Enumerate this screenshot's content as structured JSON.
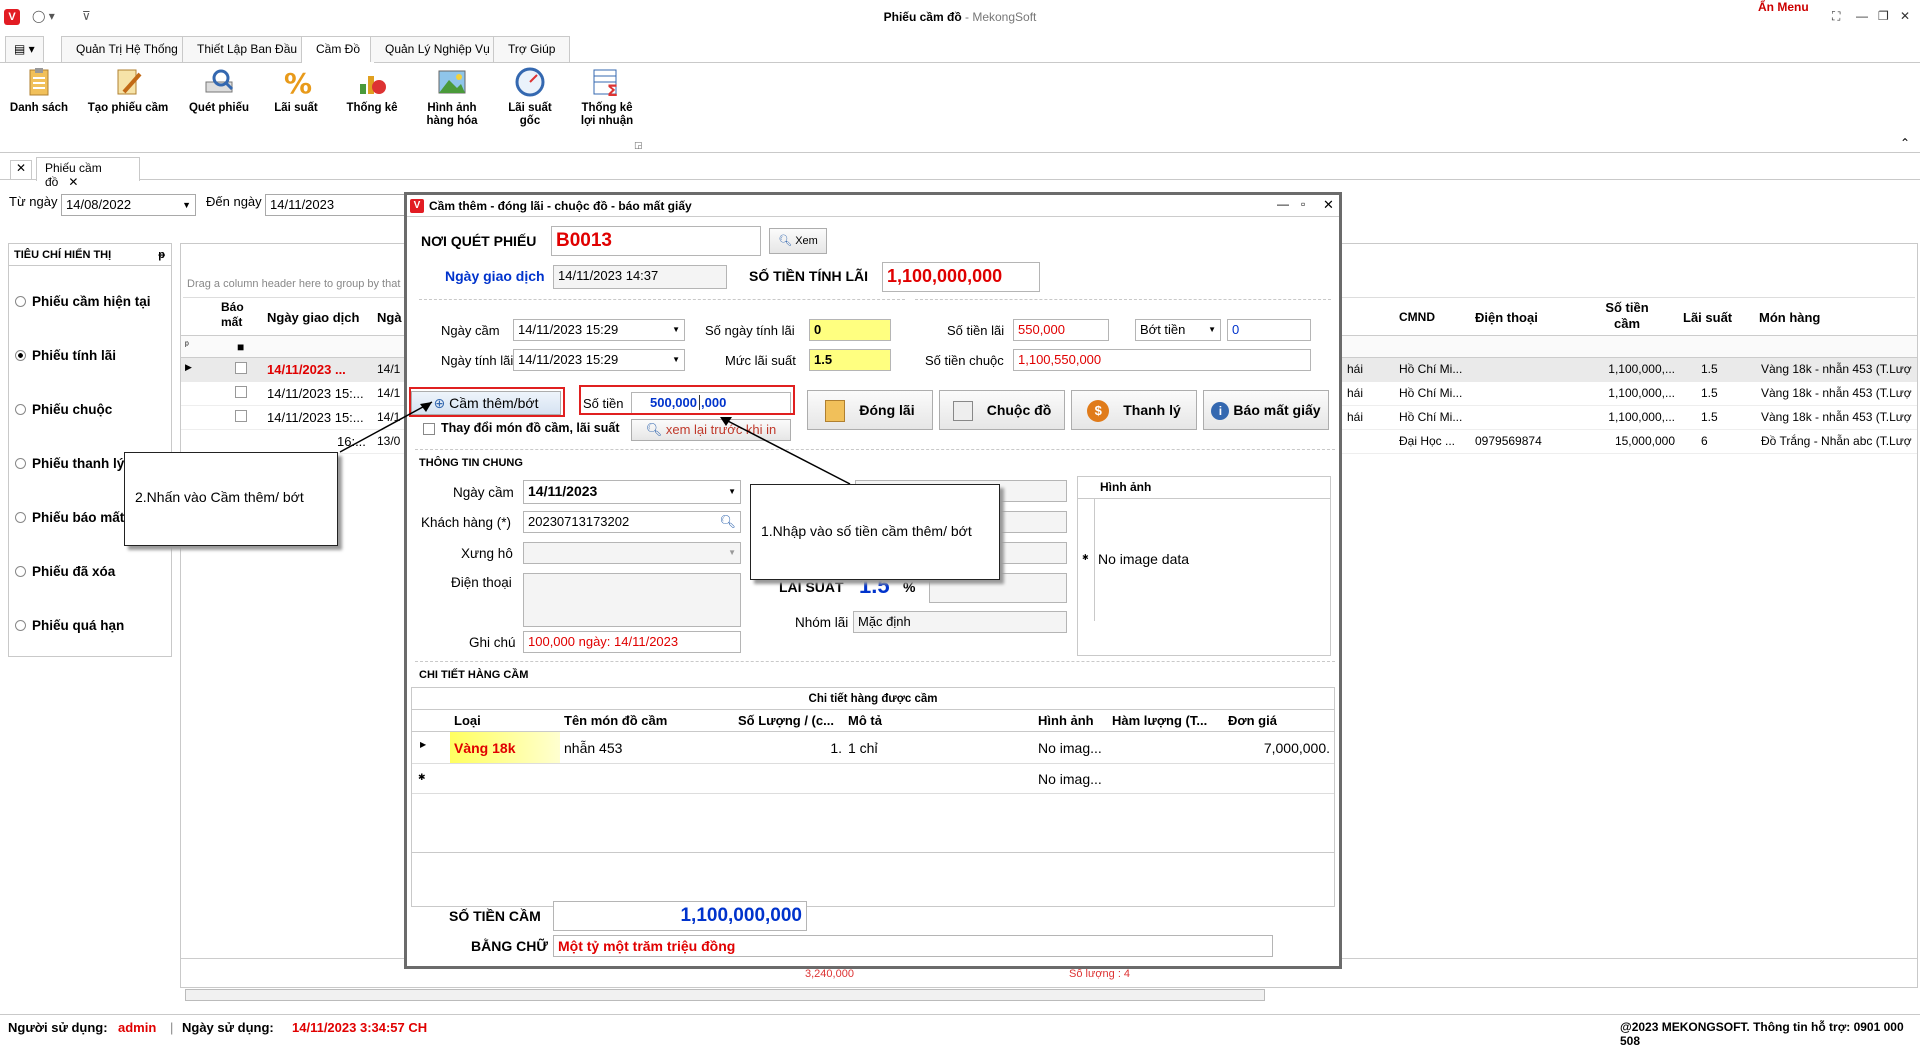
{
  "window": {
    "title": "Phiếu cầm đồ",
    "subtitle": " - MekongSoft",
    "hide_menu": "Ẩn Menu",
    "logo": "V"
  },
  "ribbon_tabs": [
    "Quản Trị Hệ Thống",
    "Thiết Lập Ban Đầu",
    "Cầm Đồ",
    "Quản Lý Nghiệp Vụ",
    "Trợ Giúp"
  ],
  "ribbon_buttons": [
    {
      "label": "Danh sách",
      "icon": "clipboard-icon"
    },
    {
      "label": "Tạo phiếu cầm",
      "icon": "edit-document-icon"
    },
    {
      "label": "Quét phiếu",
      "icon": "scanner-icon"
    },
    {
      "label": "Lãi suất",
      "icon": "percent-icon"
    },
    {
      "label": "Thống kê",
      "icon": "bar-chart-icon"
    },
    {
      "label": "Hình ảnh",
      "label2": "hàng hóa",
      "icon": "picture-icon"
    },
    {
      "label": "Lãi suất",
      "label2": "gốc",
      "icon": "gauge-icon"
    },
    {
      "label": "Thống kê",
      "label2": "lợi nhuận",
      "icon": "sum-table-icon"
    }
  ],
  "doc_tab": "Phiếu cầm đồ",
  "filter": {
    "from_label": "Từ ngày",
    "from_value": "14/08/2022",
    "to_label": "Đến ngày",
    "to_value": "14/11/2023"
  },
  "left_panel": {
    "header": "TIÊU CHÍ HIỂN THỊ",
    "pin": "ᵽ",
    "options": [
      "Phiếu cầm hiện tại",
      "Phiếu tính lãi",
      "Phiếu chuộc",
      "Phiếu thanh lý",
      "Phiếu báo mất",
      "Phiếu đã xóa",
      "Phiếu quá hạn"
    ],
    "selected": 1
  },
  "grid": {
    "group_hint": "Drag a column header here to group by that column",
    "col_bao_mat": [
      "Báo",
      "mất"
    ],
    "col_ngay": "Ngày giao dịch",
    "col_ng2": "Ngà",
    "right_cols": [
      "CMND",
      "Điện thoại",
      "Số tiền",
      "cầm",
      "Lãi suất",
      "Món hàng"
    ],
    "rows_left": [
      {
        "date": "14/11/2023 ...",
        "extra": "14/1",
        "red": true
      },
      {
        "date": "14/11/2023 15:...",
        "extra": "14/1",
        "red": false
      },
      {
        "date": "14/11/2023 15:...",
        "extra": "14/1",
        "red": false
      },
      {
        "date": "16:...",
        "extra": "13/0",
        "red": false
      }
    ],
    "rows_right": [
      {
        "pre": "hái",
        "cmnd": "Hồ Chí Mi...",
        "phone": "",
        "amount": "1,100,000,...",
        "rate": "1.5",
        "item": "Vàng 18k - nhẫn 453 (T.Lượ"
      },
      {
        "pre": "hái",
        "cmnd": "Hồ Chí Mi...",
        "phone": "",
        "amount": "1,100,000,...",
        "rate": "1.5",
        "item": "Vàng 18k - nhẫn 453 (T.Lượ"
      },
      {
        "pre": "hái",
        "cmnd": "Hồ Chí Mi...",
        "phone": "",
        "amount": "1,100,000,...",
        "rate": "1.5",
        "item": "Vàng 18k - nhẫn 453 (T.Lượ"
      },
      {
        "pre": "hái",
        "cmnd": "Đại Học ...",
        "phone": "0979569874",
        "amount": "15,000,000",
        "rate": "6",
        "item": "Đồ Trắng - Nhẫn abc (T.Lượ"
      }
    ],
    "footer_sum": "3,240,000",
    "footer_count": "Số lượng : 4"
  },
  "dialog": {
    "title": "Cầm thêm - đóng lãi - chuộc đồ - báo mất giấy",
    "noi_quet_label": "NƠI QUÉT PHIẾU",
    "noi_quet_value": "B0013",
    "xem": "Xem",
    "ngay_gd_label": "Ngày giao dịch",
    "ngay_gd_value": "14/11/2023 14:37",
    "so_tien_tinh_lai_label": "SỐ TIỀN TÍNH LÃI",
    "so_tien_tinh_lai_value": "1,100,000,000",
    "ngay_cam_label": "Ngày cầm",
    "ngay_cam_value": "14/11/2023 15:29",
    "ngay_tinh_lai_label": "Ngày tính lãi",
    "ngay_tinh_lai_value": "14/11/2023 15:29",
    "so_ngay_label": "Số ngày tính lãi",
    "so_ngay_value": "0",
    "muc_lai_label": "Mức lãi suất",
    "muc_lai_value": "1.5",
    "so_tien_lai_label": "Số tiền lãi",
    "so_tien_lai_value": "550,000",
    "bot_tien_option": "Bớt tiền",
    "bot_tien_value": "0",
    "so_tien_chuoc_label": "Số tiền chuộc",
    "so_tien_chuoc_value": "1,100,550,000",
    "cam_them_btn": "Cầm thêm/bớt",
    "so_tien_label": "Số tiền",
    "so_tien_value": "500,000",
    "so_tien_suffix": ",000",
    "thay_doi": "Thay đổi món đồ cầm, lãi suất",
    "xem_lai": "xem lại trước khi in",
    "dong_lai": "Đóng lãi",
    "chuoc_do": "Chuộc đồ",
    "thanh_ly": "Thanh lý",
    "bao_mat": "Báo mất giấy",
    "thong_tin_chung": "THÔNG TIN CHUNG",
    "tt_ngay_cam_label": "Ngày cầm",
    "tt_ngay_cam_value": "14/11/2023",
    "khach_hang_label": "Khách hàng (*)",
    "khach_hang_value": "20230713173202",
    "xung_ho_label": "Xưng hô",
    "dien_thoai_label": "Điện thoại",
    "ghi_chu_label": "Ghi chú",
    "ghi_chu_value": "100,000 ngày: 14/11/2023",
    "lai_suat_label": "LÃI SUẤT",
    "lai_suat_value": "1.5",
    "percent": "%",
    "nhom_lai_label": "Nhóm lãi",
    "nhom_lai_value": "Mặc định",
    "hinh_anh_header": "Hình ảnh",
    "no_image": "No image data",
    "chi_tiet_label": "CHI TIẾT HÀNG CẦM",
    "sub_grid_title": "Chi tiết hàng được cầm",
    "sub_cols": [
      "Loại",
      "Tên món đồ cầm",
      "Số Lượng / (c...",
      "Mô tả",
      "Hình ảnh",
      "Hàm lượng (T...",
      "Đơn giá"
    ],
    "sub_row": {
      "loai": "Vàng 18k",
      "ten": "nhẫn 453",
      "sl": "1.",
      "mota": "1 chỉ",
      "hinh": "No imag...",
      "ham": "",
      "gia": "7,000,000."
    },
    "sub_new_row_img": "No imag...",
    "so_tien_cam_label": "SỐ TIỀN CẦM",
    "so_tien_cam_value": "1,100,000,000",
    "bang_chu_label": "BẰNG CHỮ",
    "bang_chu_value": "Một tỷ một trăm triệu đồng"
  },
  "callouts": {
    "step1": "1.Nhập vào số tiền cầm thêm/ bớt",
    "step2": "2.Nhấn vào Cầm thêm/ bớt"
  },
  "status": {
    "user_label": "Người sử dụng:",
    "user_value": "admin",
    "date_label": "Ngày sử dụng:",
    "date_value": "14/11/2023 3:34:57 CH",
    "copyright": "@2023 MEKONGSOFT. Thông tin hỗ trợ: 0901 000 508"
  },
  "colors": {
    "accent_red": "#e00000",
    "accent_blue": "#0033cc",
    "yellow": "#ffff80"
  }
}
